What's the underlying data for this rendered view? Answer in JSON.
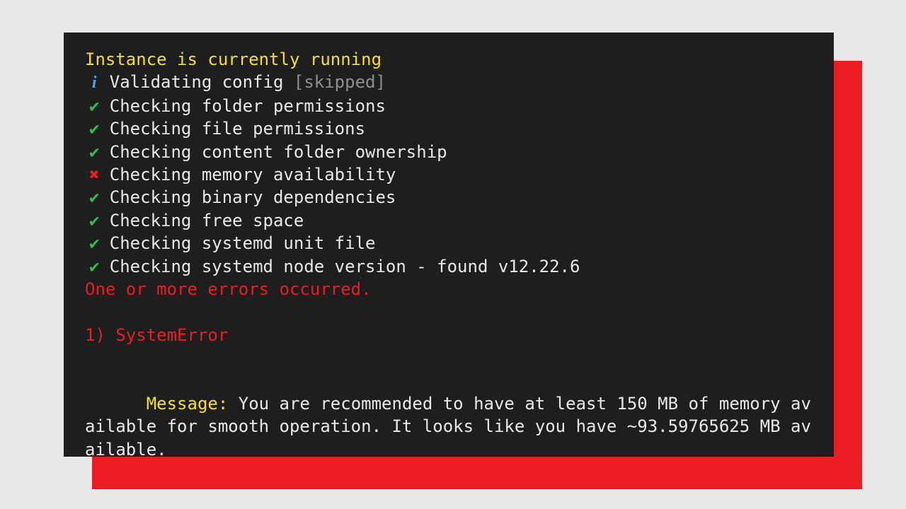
{
  "header_line": "Instance is currently running",
  "checks": [
    {
      "icon": "info",
      "text": "Validating config ",
      "extra": "[skipped]"
    },
    {
      "icon": "check",
      "text": "Checking folder permissions"
    },
    {
      "icon": "check",
      "text": "Checking file permissions"
    },
    {
      "icon": "check",
      "text": "Checking content folder ownership"
    },
    {
      "icon": "cross",
      "text": "Checking memory availability"
    },
    {
      "icon": "check",
      "text": "Checking binary dependencies"
    },
    {
      "icon": "check",
      "text": "Checking free space"
    },
    {
      "icon": "check",
      "text": "Checking systemd unit file"
    },
    {
      "icon": "check",
      "text": "Checking systemd node version - found v12.22.6"
    }
  ],
  "error_summary": "One or more errors occurred.",
  "error_heading": "1) SystemError",
  "message_label": "Message: ",
  "message_body": "You are recommended to have at least 150 MB of memory available for smooth operation. It looks like you have ~93.59765625 MB available."
}
